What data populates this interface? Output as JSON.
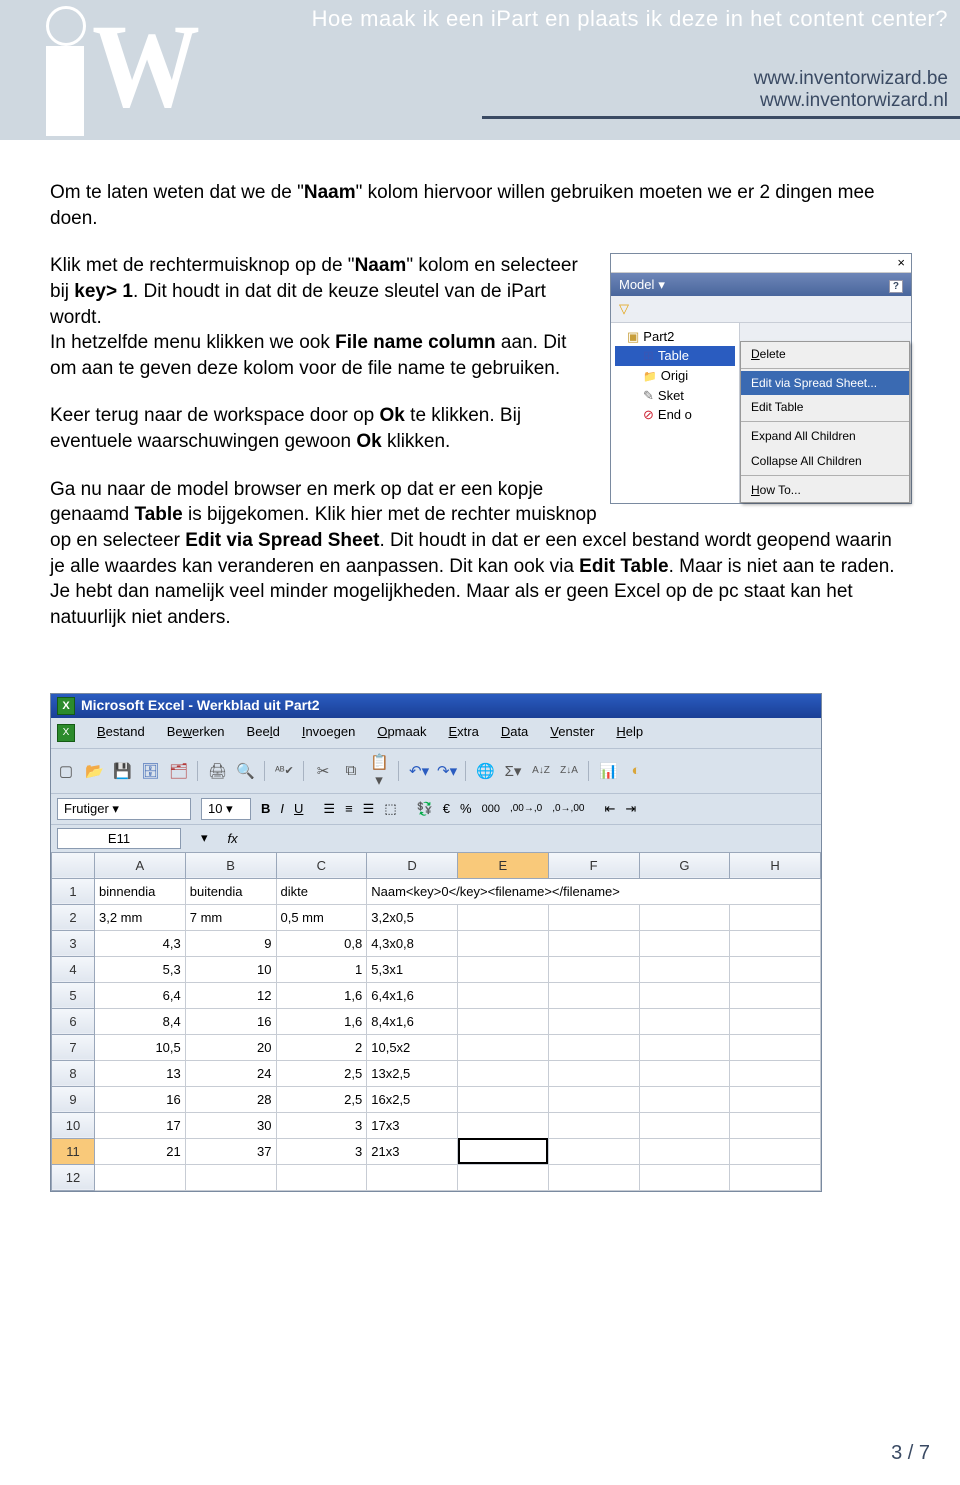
{
  "header": {
    "title": "Hoe maak ik een iPart en plaats ik deze in het content center?",
    "link1": "www.inventorwizard.be",
    "link2": "www.inventorwizard.nl"
  },
  "body": {
    "p1_a": "Om te laten weten dat we de \"",
    "p1_b": "Naam",
    "p1_c": "\" kolom hiervoor willen gebruiken moeten we er 2 dingen mee doen.",
    "p2_a": "Klik met de rechtermuisknop op de \"",
    "p2_b": "Naam",
    "p2_c": "\" kolom en selecteer bij ",
    "p2_d": "key> 1",
    "p2_e": ". Dit houdt in dat dit de keuze sleutel van de iPart wordt.",
    "p3_a": "In hetzelfde menu klikken we ook ",
    "p3_b": "File name column",
    "p3_c": " aan. Dit om aan te geven deze kolom voor de file name te gebruiken.",
    "p4_a": "Keer terug naar de workspace door op ",
    "p4_b": "Ok",
    "p4_c": " te klikken. Bij eventuele waarschuwingen gewoon ",
    "p4_d": "Ok",
    "p4_e": " klikken.",
    "p5_a": "Ga nu naar de model browser en merk op dat er een kopje genaamd ",
    "p5_b": "Table",
    "p5_c": " is bijgekomen. Klik hier met de rechter muisknop op en selecteer ",
    "p5_d": "Edit via Spread Sheet",
    "p5_e": ". Dit houdt in dat er een excel bestand wordt geopend waarin je alle waardes kan veranderen en aanpassen. Dit kan ook via ",
    "p5_f": "Edit Table",
    "p5_g": ". Maar is niet aan te raden. Je hebt dan namelijk veel minder mogelijkheden. Maar als er geen Excel op de pc staat kan het natuurlijk niet anders."
  },
  "browser": {
    "model_label": "Model",
    "tree": {
      "part": "Part2",
      "table": "Table",
      "origin": "Origi",
      "sketch": "Sket",
      "end": "End o"
    },
    "ctx": {
      "delete": "Delete",
      "edit_spread": "Edit via Spread Sheet...",
      "edit_table": "Edit Table",
      "expand": "Expand All Children",
      "collapse": "Collapse All Children",
      "howto": "How To..."
    }
  },
  "excel": {
    "title": "Microsoft Excel - Werkblad uit Part2",
    "menu": [
      "Bestand",
      "Bewerken",
      "Beeld",
      "Invoegen",
      "Opmaak",
      "Extra",
      "Data",
      "Venster",
      "Help"
    ],
    "font": "Frutiger",
    "fontsize": "10",
    "namebox": "E11",
    "fx": "fx",
    "cols": [
      "A",
      "B",
      "C",
      "D",
      "E",
      "F",
      "G",
      "H"
    ],
    "row1": [
      "binnendia",
      "buitendia",
      "dikte",
      "Naam<key>0</key><filename></filename>",
      "",
      "",
      "",
      ""
    ],
    "data": [
      [
        "2",
        "3,2 mm",
        "7 mm",
        "0,5 mm",
        "3,2x0,5",
        "",
        "",
        "",
        ""
      ],
      [
        "3",
        "4,3",
        "9",
        "0,8",
        "4,3x0,8",
        "",
        "",
        "",
        ""
      ],
      [
        "4",
        "5,3",
        "10",
        "1",
        "5,3x1",
        "",
        "",
        "",
        ""
      ],
      [
        "5",
        "6,4",
        "12",
        "1,6",
        "6,4x1,6",
        "",
        "",
        "",
        ""
      ],
      [
        "6",
        "8,4",
        "16",
        "1,6",
        "8,4x1,6",
        "",
        "",
        "",
        ""
      ],
      [
        "7",
        "10,5",
        "20",
        "2",
        "10,5x2",
        "",
        "",
        "",
        ""
      ],
      [
        "8",
        "13",
        "24",
        "2,5",
        "13x2,5",
        "",
        "",
        "",
        ""
      ],
      [
        "9",
        "16",
        "28",
        "2,5",
        "16x2,5",
        "",
        "",
        "",
        ""
      ],
      [
        "10",
        "17",
        "30",
        "3",
        "17x3",
        "",
        "",
        "",
        ""
      ],
      [
        "11",
        "21",
        "37",
        "3",
        "21x3",
        "",
        "",
        "",
        ""
      ],
      [
        "12",
        "",
        "",
        "",
        "",
        "",
        "",
        "",
        ""
      ]
    ],
    "selected_row": "11",
    "selected_col": "E"
  },
  "footer": {
    "page": "3 / 7"
  }
}
